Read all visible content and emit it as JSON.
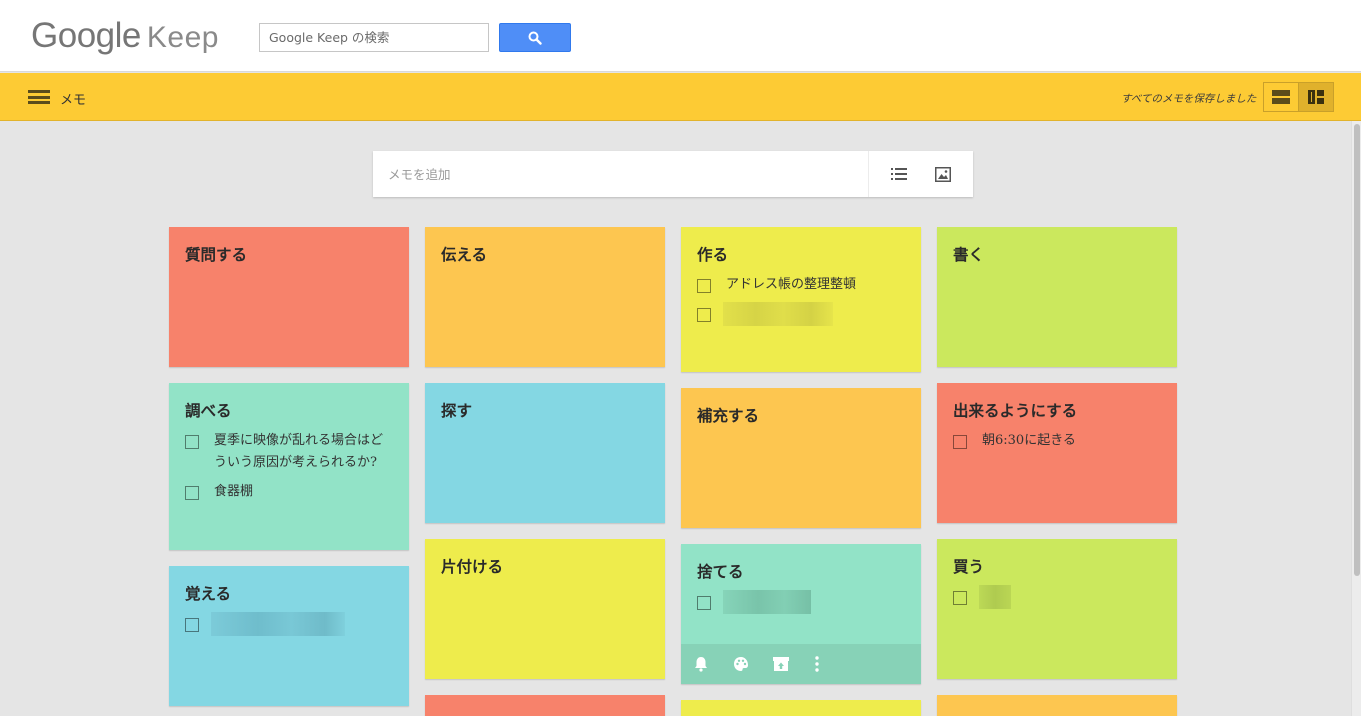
{
  "header": {
    "logo_google": "Google",
    "logo_keep": "Keep",
    "search_placeholder": "Google Keep の検索",
    "search_icon": "search-icon"
  },
  "appbar": {
    "menu_icon": "hamburger-menu-icon",
    "section_title": "メモ",
    "saved_status": "すべてのメモを保存しました",
    "view_list_icon": "list-view-icon",
    "view_grid_icon": "grid-view-icon"
  },
  "composer": {
    "placeholder": "メモを追加",
    "list_icon": "checklist-icon",
    "image_icon": "image-icon"
  },
  "colors": {
    "red": "#f7826b",
    "orange": "#fdc650",
    "yellow": "#eeec4c",
    "green": "#cbe85d",
    "teal": "#92e3c7",
    "blue": "#84d7e3",
    "appbar": "#fdcb34",
    "search_button": "#4f8ef7"
  },
  "notes": [
    {
      "title": "質問する",
      "color": "red"
    },
    {
      "title": "伝える",
      "color": "orange"
    },
    {
      "title": "作る",
      "color": "yellow",
      "items": [
        "アドレス帳の整理整頓",
        "(blurred)"
      ]
    },
    {
      "title": "書く",
      "color": "green"
    },
    {
      "title": "調べる",
      "color": "teal",
      "items": [
        "夏季に映像が乱れる場合はどういう原因が考えられるか?",
        "食器棚"
      ]
    },
    {
      "title": "探す",
      "color": "blue"
    },
    {
      "title": "補充する",
      "color": "orange"
    },
    {
      "title": "出来るようにする",
      "color": "red",
      "items": [
        "朝6:30に起きる"
      ]
    },
    {
      "title": "覚える",
      "color": "blue",
      "items": [
        "(blurred)"
      ]
    },
    {
      "title": "片付ける",
      "color": "yellow"
    },
    {
      "title": "捨てる",
      "color": "teal",
      "items": [
        "(blurred)"
      ],
      "toolbar": [
        "reminder-bell-icon",
        "color-palette-icon",
        "archive-icon",
        "more-vert-icon"
      ]
    },
    {
      "title": "買う",
      "color": "green",
      "items": [
        "(blurred)"
      ]
    },
    {
      "color": "red"
    },
    {
      "color": "yellow"
    },
    {
      "color": "orange"
    }
  ]
}
